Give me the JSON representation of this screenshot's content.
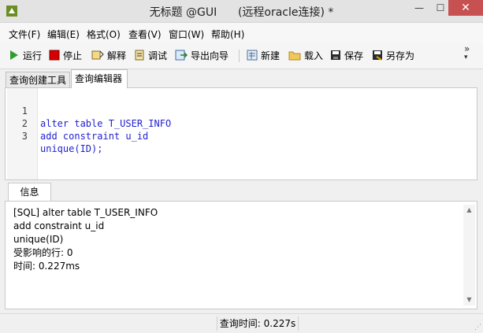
{
  "window": {
    "title": "无标题 @GUI      (远程oracle连接) *",
    "controls": {
      "minimize": "—",
      "maximize": "☐",
      "close": "✕"
    }
  },
  "menu": {
    "items": [
      "文件(F)",
      "编辑(E)",
      "格式(O)",
      "查看(V)",
      "窗口(W)",
      "帮助(H)"
    ]
  },
  "toolbar": {
    "run": "运行",
    "stop": "停止",
    "explain": "解释",
    "debug": "调试",
    "export_wizard": "导出向导",
    "new": "新建",
    "load": "载入",
    "save": "保存",
    "save_as": "另存为",
    "overflow": "»"
  },
  "tabs": [
    {
      "label": "查询创建工具"
    },
    {
      "label": "查询编辑器"
    }
  ],
  "editor": {
    "lines": [
      {
        "num": "1",
        "code": "alter table T_USER_INFO"
      },
      {
        "num": "2",
        "code": "add constraint u_id"
      },
      {
        "num": "3",
        "code": "unique(ID);"
      }
    ]
  },
  "info": {
    "tab": "信息",
    "lines": [
      "[SQL] alter table T_USER_INFO",
      "add constraint u_id",
      "unique(ID)",
      "受影响的行: 0",
      "时间: 0.227ms"
    ]
  },
  "status": {
    "query_time": "查询时间: 0.227s"
  },
  "colors": {
    "close_button": "#c75050",
    "sql_keyword": "#1f1fd0",
    "run_icon": "#2e9e2e",
    "stop_icon": "#d40000"
  }
}
